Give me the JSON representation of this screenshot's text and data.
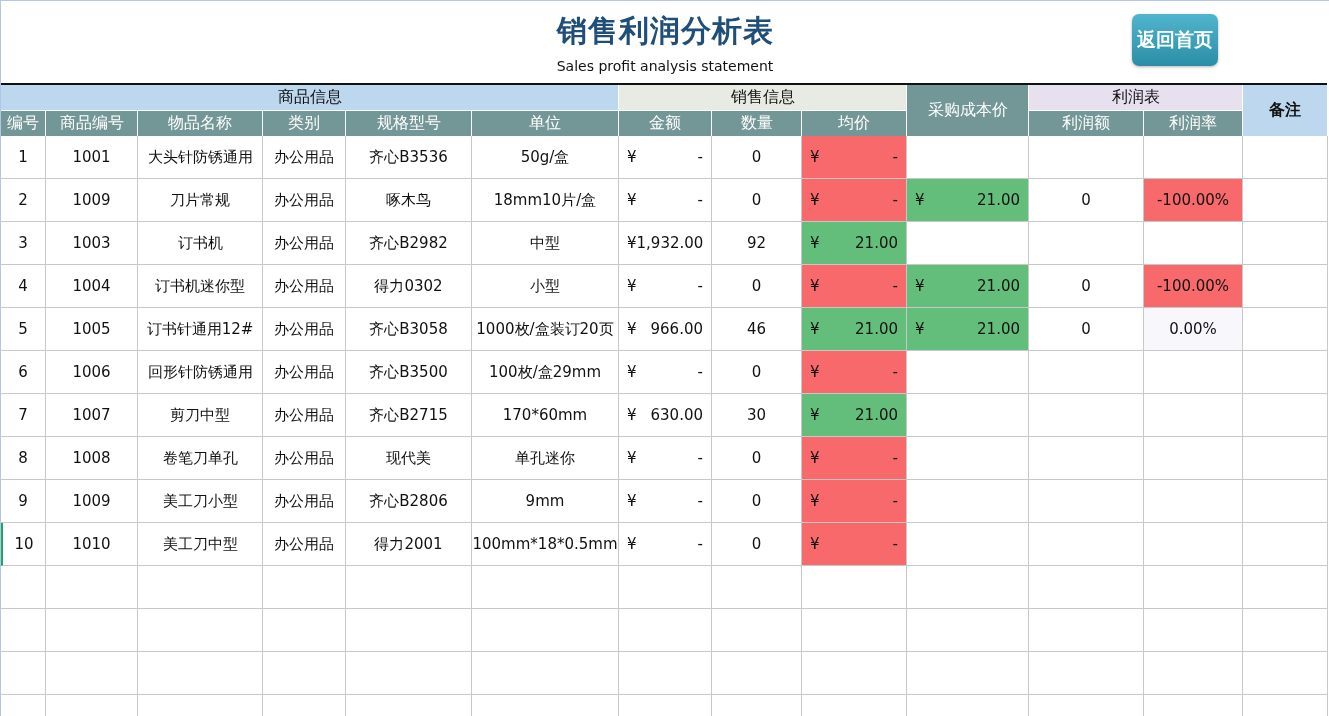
{
  "title": "销售利润分析表",
  "subtitle": "Sales profit analysis statement",
  "home_button": "返回首页",
  "header_groups": [
    {
      "kind": "group",
      "label": "商品信息",
      "color": "#bdd7ee",
      "columns": [
        "编号",
        "商品编号",
        "物品名称",
        "类别",
        "规格型号",
        "单位"
      ]
    },
    {
      "kind": "group",
      "label": "销售信息",
      "color": "#e7ebe3",
      "columns": [
        "金额",
        "数量",
        "均价"
      ]
    },
    {
      "kind": "single",
      "label": "采购成本价",
      "color": "#739797"
    },
    {
      "kind": "group",
      "label": "利润表",
      "color": "#e6e0ef",
      "columns": [
        "利润额",
        "利润率"
      ]
    },
    {
      "kind": "single",
      "label": "备注",
      "color": "#bdd7ee"
    }
  ],
  "rows": [
    {
      "no": "1",
      "code": "1001",
      "name": "大头针防锈通用",
      "category": "办公用品",
      "spec": "齐心B3536",
      "unit": "50g/盒",
      "amount": {
        "symbol": "¥",
        "value": "-"
      },
      "qty": "0",
      "avg": {
        "symbol": "¥",
        "value": "-",
        "color": "#f8696b"
      }
    },
    {
      "no": "2",
      "code": "1009",
      "name": "刀片常规",
      "category": "办公用品",
      "spec": "啄木鸟",
      "unit": "18mm10片/盒",
      "amount": {
        "symbol": "¥",
        "value": "-"
      },
      "qty": "0",
      "avg": {
        "symbol": "¥",
        "value": "-",
        "color": "#f8696b"
      },
      "cost": {
        "symbol": "¥",
        "value": "21.00",
        "color": "#63be7b"
      },
      "profit": "0",
      "rate": {
        "text": "-100.00%",
        "color": "#f8696b"
      }
    },
    {
      "no": "3",
      "code": "1003",
      "name": "订书机",
      "category": "办公用品",
      "spec": "齐心B2982",
      "unit": "中型",
      "amount": {
        "symbol": "¥",
        "value": "1,932.00"
      },
      "qty": "92",
      "avg": {
        "symbol": "¥",
        "value": "21.00",
        "color": "#63be7b"
      }
    },
    {
      "no": "4",
      "code": "1004",
      "name": "订书机迷你型",
      "category": "办公用品",
      "spec": "得力0302",
      "unit": "小型",
      "amount": {
        "symbol": "¥",
        "value": "-"
      },
      "qty": "0",
      "avg": {
        "symbol": "¥",
        "value": "-",
        "color": "#f8696b"
      },
      "cost": {
        "symbol": "¥",
        "value": "21.00",
        "color": "#63be7b"
      },
      "profit": "0",
      "rate": {
        "text": "-100.00%",
        "color": "#f8696b"
      }
    },
    {
      "no": "5",
      "code": "1005",
      "name": "订书针通用12#",
      "category": "办公用品",
      "spec": "齐心B3058",
      "unit": "1000枚/盒装订20页",
      "amount": {
        "symbol": "¥",
        "value": "966.00"
      },
      "qty": "46",
      "avg": {
        "symbol": "¥",
        "value": "21.00",
        "color": "#63be7b"
      },
      "cost": {
        "symbol": "¥",
        "value": "21.00",
        "color": "#63be7b"
      },
      "profit": "0",
      "rate": {
        "text": "0.00%",
        "color": "#f8f8fc"
      }
    },
    {
      "no": "6",
      "code": "1006",
      "name": "回形针防锈通用",
      "category": "办公用品",
      "spec": "齐心B3500",
      "unit": "100枚/盒29mm",
      "amount": {
        "symbol": "¥",
        "value": "-"
      },
      "qty": "0",
      "avg": {
        "symbol": "¥",
        "value": "-",
        "color": "#f8696b"
      }
    },
    {
      "no": "7",
      "code": "1007",
      "name": "剪刀中型",
      "category": "办公用品",
      "spec": "齐心B2715",
      "unit": "170*60mm",
      "amount": {
        "symbol": "¥",
        "value": "630.00"
      },
      "qty": "30",
      "avg": {
        "symbol": "¥",
        "value": "21.00",
        "color": "#63be7b"
      }
    },
    {
      "no": "8",
      "code": "1008",
      "name": "卷笔刀单孔",
      "category": "办公用品",
      "spec": "现代美",
      "unit": "单孔迷你",
      "amount": {
        "symbol": "¥",
        "value": "-"
      },
      "qty": "0",
      "avg": {
        "symbol": "¥",
        "value": "-",
        "color": "#f8696b"
      }
    },
    {
      "no": "9",
      "code": "1009",
      "name": "美工刀小型",
      "category": "办公用品",
      "spec": "齐心B2806",
      "unit": "9mm",
      "amount": {
        "symbol": "¥",
        "value": "-"
      },
      "qty": "0",
      "avg": {
        "symbol": "¥",
        "value": "-",
        "color": "#f8696b"
      }
    },
    {
      "no": "10",
      "code": "1010",
      "name": "美工刀中型",
      "category": "办公用品",
      "spec": "得力2001",
      "unit": "100mm*18*0.5mm",
      "amount": {
        "symbol": "¥",
        "value": "-"
      },
      "qty": "0",
      "avg": {
        "symbol": "¥",
        "value": "-",
        "color": "#f8696b"
      }
    }
  ]
}
